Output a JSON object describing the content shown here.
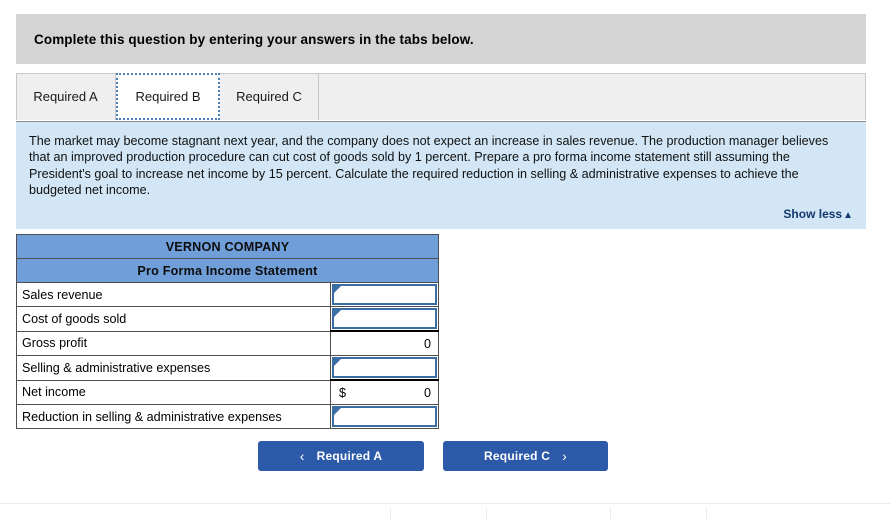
{
  "banner": {
    "text": "Complete this question by entering your answers in the tabs below."
  },
  "tabs": {
    "items": [
      {
        "label": "Required A",
        "active": false
      },
      {
        "label": "Required B",
        "active": true
      },
      {
        "label": "Required C",
        "active": false
      }
    ]
  },
  "question": {
    "body": "The market may become stagnant next year, and the company does not expect an increase in sales revenue. The production manager believes that an improved production procedure can cut cost of goods sold by 1 percent. Prepare a pro forma income statement still assuming the President's goal to increase net income by 15 percent. Calculate the required reduction in selling & administrative expenses to achieve the budgeted net income.",
    "show_less_label": "Show less",
    "show_less_caret": "▲"
  },
  "statement": {
    "company": "VERNON COMPANY",
    "title": "Pro Forma Income Statement",
    "rows": [
      {
        "label": "Sales revenue",
        "type": "entry",
        "currency": "",
        "value": ""
      },
      {
        "label": "Cost of goods sold",
        "type": "entry",
        "currency": "",
        "value": ""
      },
      {
        "label": "Gross profit",
        "type": "readonly",
        "currency": "",
        "value": "0",
        "topline": true
      },
      {
        "label": "Selling & administrative expenses",
        "type": "entry",
        "currency": "",
        "value": ""
      },
      {
        "label": "Net income",
        "type": "readonly",
        "currency": "$",
        "value": "0",
        "topline": true
      },
      {
        "label": "Reduction in selling & administrative expenses",
        "type": "entry",
        "currency": "",
        "value": ""
      }
    ]
  },
  "nav": {
    "prev_label": "Required A",
    "prev_chevron": "‹",
    "next_label": "Required C",
    "next_chevron": "›"
  },
  "colors": {
    "banner_bg": "#d4d4d4",
    "panel_bg": "#d2e6f5",
    "table_header_bg": "#6f9ed9",
    "entry_border": "#3a6ea5",
    "button_bg": "#2c5aa8",
    "link": "#14396e"
  }
}
